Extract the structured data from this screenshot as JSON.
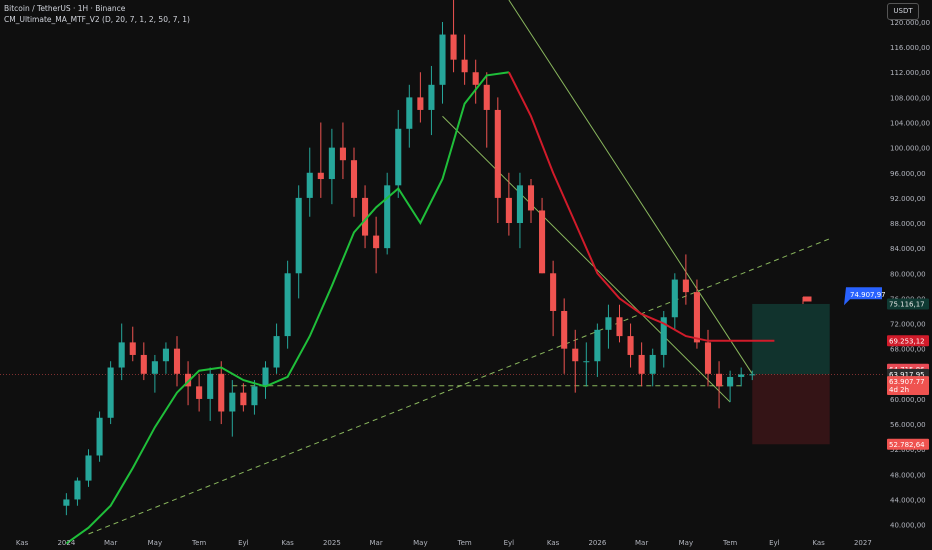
{
  "header": {
    "symbol_line": "Bitcoin / TetherUS · 1H · Binance",
    "indicator_line": "CM_Ultimate_MA_MTF_V2 (D, 20, 7, 1, 2, 50, 7, 1)"
  },
  "currency_button": "USDT",
  "colors": {
    "background": "#0f0f0f",
    "up_candle": "#26a69a",
    "down_candle": "#ef5350",
    "ma_rising": "#1fbf3a",
    "ma_falling": "#d11b2a",
    "trendline": "#9fd36b",
    "long_profit_zone": "#123a33",
    "long_stop_zone": "#3b1518"
  },
  "chart_data": {
    "type": "candlestick",
    "title": "Bitcoin / TetherUS · 1H · Binance",
    "y_axis": {
      "side": "right",
      "range": [
        38500,
        123500
      ],
      "tick_labels": [
        "120.000,00",
        "116.000,00",
        "112.000,00",
        "108.000,00",
        "104.000,00",
        "100.000,00",
        "96.000,00",
        "92.000,00",
        "88.000,00",
        "84.000,00",
        "80.000,00",
        "76.000,00",
        "72.000,00",
        "68.000,00",
        "64.000,00",
        "60.000,00",
        "56.000,00",
        "52.000,00",
        "48.000,00",
        "44.000,00",
        "40.000,00"
      ],
      "tick_values": [
        120000,
        116000,
        112000,
        108000,
        104000,
        100000,
        96000,
        92000,
        88000,
        84000,
        80000,
        76000,
        72000,
        68000,
        64000,
        60000,
        56000,
        52000,
        48000,
        44000,
        40000
      ]
    },
    "x_axis": {
      "tick_labels": [
        "Kas",
        "2024",
        "Mar",
        "May",
        "Tem",
        "Eyl",
        "Kas",
        "2025",
        "Mar",
        "May",
        "Tem",
        "Eyl",
        "Kas",
        "2026",
        "Mar",
        "May",
        "Tem",
        "Eyl",
        "Kas",
        "2027"
      ],
      "tick_months": [
        -2,
        0,
        2,
        4,
        6,
        8,
        10,
        12,
        14,
        16,
        18,
        20,
        22,
        24,
        26,
        28,
        30,
        32,
        34,
        36
      ],
      "range_months": [
        -3,
        37
      ]
    },
    "grid": false,
    "candles": {
      "month_index": [
        0,
        0.5,
        1,
        1.5,
        2,
        2.5,
        3,
        3.5,
        4,
        4.5,
        5,
        5.5,
        6,
        6.5,
        7,
        7.5,
        8,
        8.5,
        9,
        9.5,
        10,
        10.5,
        11,
        11.5,
        12,
        12.5,
        13,
        13.5,
        14,
        14.5,
        15,
        15.5,
        16,
        16.5,
        17,
        17.5,
        18,
        18.5,
        19,
        19.5,
        20,
        20.5,
        21,
        21.5,
        22,
        22.5,
        23,
        23.5,
        24,
        24.5,
        25,
        25.5,
        26,
        26.5,
        27,
        27.5,
        28,
        28.5,
        29,
        29.5,
        30,
        30.5,
        31
      ],
      "open": [
        43000,
        44000,
        47000,
        51000,
        57000,
        65000,
        69000,
        67000,
        64000,
        66000,
        68000,
        64000,
        62000,
        60000,
        64000,
        58000,
        61000,
        59000,
        62000,
        65000,
        70000,
        80000,
        92000,
        96000,
        95000,
        100000,
        98000,
        92000,
        86000,
        84000,
        94000,
        103000,
        108000,
        106000,
        110000,
        118000,
        114000,
        112000,
        110000,
        106000,
        92000,
        88000,
        94000,
        90000,
        80000,
        74000,
        68000,
        66000,
        66000,
        71000,
        73000,
        70000,
        67000,
        64000,
        67000,
        73000,
        79000,
        77000,
        69000,
        64000,
        62000,
        63500,
        63900
      ],
      "high": [
        45000,
        47500,
        52000,
        58000,
        66000,
        72000,
        71500,
        69000,
        67000,
        69000,
        70000,
        66000,
        64000,
        65000,
        66000,
        63000,
        62500,
        63000,
        66000,
        72000,
        82000,
        94000,
        100000,
        104000,
        103000,
        104000,
        100000,
        94000,
        89000,
        96000,
        106000,
        110000,
        112000,
        113000,
        120000,
        124000,
        118000,
        114000,
        112000,
        108000,
        96000,
        96000,
        95000,
        92000,
        82000,
        76000,
        71000,
        69000,
        72000,
        75000,
        75000,
        72000,
        69000,
        68000,
        74000,
        80000,
        83000,
        79000,
        71000,
        66000,
        64500,
        65000,
        64500
      ],
      "low": [
        41500,
        43000,
        46000,
        50000,
        56000,
        63000,
        66000,
        63000,
        61000,
        64000,
        62000,
        59000,
        58000,
        56500,
        56000,
        54000,
        58000,
        57500,
        60000,
        64000,
        68000,
        76000,
        89000,
        92000,
        91000,
        95000,
        89000,
        84000,
        80000,
        83000,
        92000,
        100000,
        104000,
        102000,
        107000,
        112000,
        110000,
        107000,
        100000,
        88000,
        86000,
        84000,
        88000,
        80000,
        70000,
        64000,
        61000,
        62000,
        63500,
        68000,
        69000,
        65000,
        62000,
        62000,
        65000,
        71000,
        75000,
        68000,
        62000,
        58500,
        59500,
        62000,
        63000
      ],
      "close": [
        44000,
        47000,
        51000,
        57000,
        65000,
        69000,
        67000,
        64000,
        66000,
        68000,
        64000,
        62000,
        60000,
        64000,
        58000,
        61000,
        59000,
        62000,
        65000,
        70000,
        80000,
        92000,
        96000,
        95000,
        100000,
        98000,
        92000,
        86000,
        84000,
        94000,
        103000,
        108000,
        106000,
        110000,
        118000,
        114000,
        112000,
        110000,
        106000,
        92000,
        88000,
        94000,
        90000,
        80000,
        74000,
        68000,
        66000,
        66000,
        71000,
        73000,
        70000,
        67000,
        64000,
        67000,
        73000,
        79000,
        77000,
        69000,
        64000,
        62000,
        63500,
        63900,
        63917
      ]
    },
    "moving_average": {
      "name": "",
      "month_index": [
        0,
        1,
        2,
        3,
        4,
        5,
        6,
        7,
        8,
        9,
        10,
        11,
        12,
        13,
        14,
        15,
        16,
        17,
        18,
        19,
        20,
        21,
        22,
        23,
        24,
        25,
        26,
        27,
        28,
        29,
        30,
        31,
        32
      ],
      "values": [
        37000,
        39500,
        43000,
        49000,
        55500,
        61000,
        64500,
        65000,
        63000,
        62000,
        63500,
        70000,
        78000,
        86500,
        90500,
        93500,
        88000,
        95000,
        107000,
        111500,
        112000,
        105000,
        96000,
        88000,
        80000,
        76000,
        73500,
        72000,
        70000,
        69253,
        69253,
        69253,
        69253
      ],
      "falling_from_month": 20
    },
    "trend_lines": [
      {
        "style": "solid",
        "from": [
          20,
          123500
        ],
        "to": [
          31,
          64000
        ]
      },
      {
        "style": "solid",
        "from": [
          17,
          105000
        ],
        "to": [
          30,
          59500
        ]
      },
      {
        "style": "dashed",
        "from": [
          1,
          38500
        ],
        "to": [
          34.5,
          85500
        ]
      },
      {
        "style": "dashed",
        "from": [
          7.5,
          62100
        ],
        "to": [
          30.5,
          62100
        ]
      }
    ],
    "position_tool": {
      "entry": 63917.95,
      "target": 75116.17,
      "stop": 52782.64,
      "from_month": 31,
      "to_month": 34.5
    },
    "price_labels": [
      {
        "text": "75.116,17",
        "value": 75116.17,
        "bg": "#0f3a33",
        "fg": "#e6e6e6"
      },
      {
        "text": "69.253,12",
        "value": 69253.12,
        "bg": "#d11b2a",
        "fg": "#ffffff"
      },
      {
        "text": "64.715,86",
        "value": 64715.86,
        "bg": "#e84a55",
        "fg": "#ffffff"
      },
      {
        "text": "63.917,95",
        "value": 63917.95,
        "bg": "#2b2b2b",
        "fg": "#ffffff"
      },
      {
        "text": "63.907,77",
        "value": 62750,
        "bg": "#ef5350",
        "fg": "#ffffff"
      },
      {
        "text": "4d 2h",
        "value": 61500,
        "bg": "#ef5350",
        "fg": "#ffffff"
      },
      {
        "text": "52.782,64",
        "value": 52782.64,
        "bg": "#ef5350",
        "fg": "#ffffff"
      }
    ],
    "tooltip_label": "74.907,97",
    "tooltip_value": 76500
  }
}
